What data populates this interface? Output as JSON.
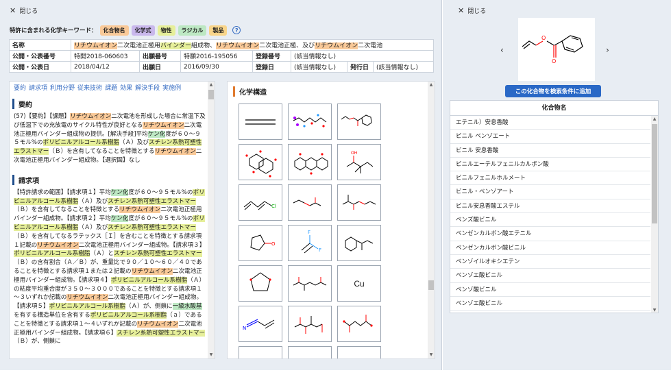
{
  "left_panel": {
    "close_label": "閉じる",
    "keyword_label": "特許に含まれる化学キーワード：",
    "keyword_tags": [
      {
        "label": "化合物名",
        "color": "#f9c998"
      },
      {
        "label": "化学式",
        "color": "#c9b8ec"
      },
      {
        "label": "物性",
        "color": "#e6ef9a"
      },
      {
        "label": "ラジカル",
        "color": "#bde8c3"
      },
      {
        "label": "製品",
        "color": "#f9d58a"
      }
    ],
    "help_icon": "?",
    "meta": {
      "name_label": "名称",
      "name_parts": [
        "リチウムイオン",
        "二次電池正極用",
        "バインダー",
        "組成物、",
        "リチウムイオン",
        "二次電池正極、及び",
        "リチウムイオン",
        "二次電池"
      ],
      "pub_num_label": "公開・公表番号",
      "pub_num": "特開2018-060603",
      "app_num_label": "出願番号",
      "app_num": "特願2016-195056",
      "reg_num_label": "登録番号",
      "reg_num": "(該当情報なし)",
      "pub_date_label": "公開・公表日",
      "pub_date": "2018/04/12",
      "app_date_label": "出願日",
      "app_date": "2016/09/30",
      "reg_date_label": "登録日",
      "reg_date": "(該当情報なし)",
      "issue_date_label": "発行日",
      "issue_date": "(該当情報なし)"
    },
    "tabs": [
      "要約",
      "請求項",
      "利用分野",
      "従来技術",
      "課題",
      "効果",
      "解決手段",
      "実施例"
    ],
    "abstract_title": "要約",
    "abstract_parts": [
      {
        "t": "(57)【要約】【課題】"
      },
      {
        "t": "リチウムイオン",
        "c": "o"
      },
      {
        "t": "二次電池を形成した場合に常温下及び低温下での充放電のサイクル特性が良好となる"
      },
      {
        "t": "リチウムイオン",
        "c": "o"
      },
      {
        "t": "二次電池正極用バインダー組成物の提供。[解決手段]平均"
      },
      {
        "t": "ケン化",
        "c": "g"
      },
      {
        "t": "度が６０～９５モル%の"
      },
      {
        "t": "ポリビニルアルコール系樹脂",
        "c": "y"
      },
      {
        "t": "（Ａ）及び"
      },
      {
        "t": "スチレン系熱可塑性エラストマー",
        "c": "y"
      },
      {
        "t": "（Ｂ）を含有してなることを特徴とする"
      },
      {
        "t": "リチウムイオン",
        "c": "o"
      },
      {
        "t": "二次電池正極用バインダー組成物。【選択図】なし"
      }
    ],
    "claims_title": "請求項",
    "claims_parts": [
      {
        "t": "【特許請求の範囲】【請求項１】平均"
      },
      {
        "t": "ケン化",
        "c": "g"
      },
      {
        "t": "度が６０～９５モル%の"
      },
      {
        "t": "ポリビニルアルコール系樹脂",
        "c": "y"
      },
      {
        "t": "（Ａ）及び"
      },
      {
        "t": "スチレン系熱可塑性エラストマー",
        "c": "y"
      },
      {
        "t": "（Ｂ）を含有してなることを特徴とする"
      },
      {
        "t": "リチウムイオン",
        "c": "o"
      },
      {
        "t": "二次電池正極用バインダー組成物。"
      },
      {
        "t": "【請求項２】平均"
      },
      {
        "t": "ケン化",
        "c": "g"
      },
      {
        "t": "度が６０～９５モル%の"
      },
      {
        "t": "ポリビニルアルコール系樹脂",
        "c": "y"
      },
      {
        "t": "（Ａ）及び"
      },
      {
        "t": "スチレン系熱可塑性エラストマー",
        "c": "y"
      },
      {
        "t": "（Ｂ）を含有してなるラテックス［Ｉ］を含むことを特徴とする請求項１記載の"
      },
      {
        "t": "リチウムイオン",
        "c": "o"
      },
      {
        "t": "二次電池正極用バインダー組成物。"
      },
      {
        "t": "【請求項３】"
      },
      {
        "t": "ポリビニルアルコール系樹脂",
        "c": "y"
      },
      {
        "t": "（Ａ）と"
      },
      {
        "t": "スチレン系熱可塑性エラストマー",
        "c": "y"
      },
      {
        "t": "（Ｂ）の含有割合（Ａ／Ｂ）が、重量比で９０／１０～６０／４０であることを特徴とする請求項１または２記載の"
      },
      {
        "t": "リチウムイオン",
        "c": "o"
      },
      {
        "t": "二次電池正極用バインダー組成物。"
      },
      {
        "t": "【請求項４】"
      },
      {
        "t": "ポリビニルアルコール系樹脂",
        "c": "y"
      },
      {
        "t": "（Ａ）の粘度平均重合度が３５０～３０００であることを特徴とする請求項１～３いずれか記載の"
      },
      {
        "t": "リチウムイオン",
        "c": "o"
      },
      {
        "t": "二次電池正極用バインダー組成物。"
      },
      {
        "t": "【請求項５】"
      },
      {
        "t": "ポリビニルアルコール系樹脂",
        "c": "y"
      },
      {
        "t": "（Ａ）が、側鎖に"
      },
      {
        "t": "一級水酸基",
        "c": "g"
      },
      {
        "t": "を有する構造単位を含有する"
      },
      {
        "t": "ポリビニルアルコール系樹脂",
        "c": "y"
      },
      {
        "t": "（ａ）であることを特徴とする請求項１～４いずれか記載の"
      },
      {
        "t": "リチウムイオン",
        "c": "o"
      },
      {
        "t": "二次電池正極用バインダー組成物。"
      },
      {
        "t": "【請求項６】"
      },
      {
        "t": "スチレン系熱可塑性エラストマー",
        "c": "y"
      },
      {
        "t": "（Ｂ）が、側鎖に"
      }
    ],
    "struct_title": "化学構造",
    "structures": [
      "double-line",
      "fluorinated-chain",
      "vinyl-benzoate",
      "sugar-ring-a",
      "sugar-ring-b",
      "branched-alkane",
      "chloro-diene",
      "vinyl-acetate",
      "allyl-methacrylate",
      "lactone",
      "difluoro-ethylene",
      "phenyl-butane",
      "dioxolane",
      "diester",
      "copper-element",
      "acrylonitrile",
      "triester",
      "diacid",
      "partial-a",
      "partial-b",
      "partial-c"
    ],
    "copper_label": "Cu"
  },
  "right_panel": {
    "close_label": "閉じる",
    "prev_icon": "‹",
    "next_icon": "›",
    "add_button": "この化合物を検索条件に追加",
    "names_header": "化合物名",
    "names": [
      "エテニル）安息香酸",
      "ビニル ベンゾエート",
      "ビニル 安息香酸",
      "ビニルエーテルフェニルカルボン酸",
      "ビニルフェニルホルメート",
      "ビニル・ベンゾアート",
      "ビニル安息香酸エステル",
      "ベンズ酸ビニル",
      "ベンゼンカルボン酸エテニル",
      "ベンゼンカルボン酸ビニル",
      "ベンゾイルオキシエテン",
      "ベンゾエ酸ビニル",
      "ベンゾ酸ビニル",
      "ベンゾエ酸ビニル"
    ]
  }
}
